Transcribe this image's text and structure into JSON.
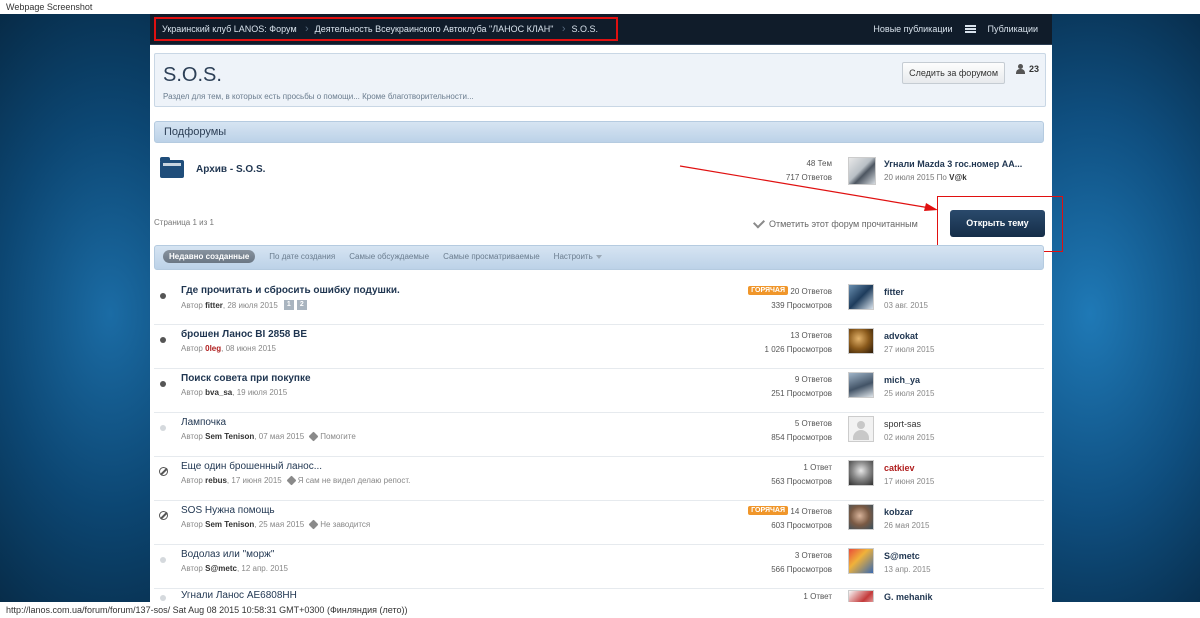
{
  "window": {
    "caption_top": "Webpage Screenshot",
    "caption_bottom": "http://lanos.com.ua/forum/forum/137-sos/ Sat Aug 08 2015 10:58:31 GMT+0300 (Финляндия (лето))"
  },
  "breadcrumb": [
    {
      "label": "Украинский клуб LANOS: Форум"
    },
    {
      "label": "Деятельность Всеукраинского Автоклуба \"ЛАНОС КЛАН\""
    },
    {
      "label": "S.O.S."
    }
  ],
  "topnav": {
    "new_posts": "Новые публикации",
    "publications": "Публикации"
  },
  "forum": {
    "title": "S.O.S.",
    "description": "Раздел для тем, в которых есть просьбы о помощи... Кроме благотворительности...",
    "follow_label": "Следить за форумом",
    "followers": "23"
  },
  "subforums": {
    "header": "Подфорумы",
    "items": [
      {
        "name": "Архив - S.O.S.",
        "topics": "48 Тем",
        "replies": "717 Ответов",
        "last_title": "Угнали Mazda 3 гос.номер АА...",
        "last_date": "20 июля 2015",
        "last_by_prefix": "По",
        "last_by": "V@k"
      }
    ]
  },
  "pagination": {
    "label": "Страница 1 из 1"
  },
  "actions": {
    "mark_read": "Отметить этот форум прочитанным",
    "new_topic": "Открыть тему"
  },
  "tabs": [
    {
      "label": "Недавно созданные",
      "active": true
    },
    {
      "label": "По дате создания"
    },
    {
      "label": "Самые обсуждаемые"
    },
    {
      "label": "Самые просматриваемые"
    },
    {
      "label": "Настроить"
    }
  ],
  "topics": [
    {
      "title": "Где прочитать и сбросить ошибку подушки.",
      "status": "unread",
      "author_prefix": "Автор",
      "author": "fitter",
      "date": "28 июля 2015",
      "pages": [
        "1",
        "2"
      ],
      "hot": "ГОРЯЧАЯ",
      "replies": "20 Ответов",
      "views": "339 Просмотров",
      "last_user": "fitter",
      "last_date": "03 авг. 2015"
    },
    {
      "title": "брошен Ланос BI 2858 BE",
      "status": "unread",
      "author_prefix": "Автор",
      "author": "0leg",
      "author_red": true,
      "date": "08 июня 2015",
      "replies": "13 Ответов",
      "views": "1 026 Просмотров",
      "last_user": "advokat",
      "last_date": "27 июля 2015"
    },
    {
      "title": "Поиск совета при покупке",
      "status": "unread",
      "author_prefix": "Автор",
      "author": "bva_sa",
      "date": "19 июля 2015",
      "replies": "9 Ответов",
      "views": "251 Просмотров",
      "last_user": "mich_ya",
      "last_date": "25 июля 2015"
    },
    {
      "title": "Лампочка",
      "status": "read",
      "author_prefix": "Автор",
      "author": "Sem Tenison",
      "date": "07 мая 2015",
      "tag": "Помогите",
      "replies": "5 Ответов",
      "views": "854 Просмотров",
      "last_user": "sport-sas",
      "last_user_plain": true,
      "last_date": "02 июля 2015"
    },
    {
      "title": "Еще один брошенный ланос...",
      "status": "locked",
      "author_prefix": "Автор",
      "author": "rebus",
      "date": "17 июня 2015",
      "tag": "Я сам не видел делаю репост.",
      "replies": "1 Ответ",
      "views": "563 Просмотров",
      "last_user": "catkiev",
      "last_user_red": true,
      "last_date": "17 июня 2015"
    },
    {
      "title": "SOS Нужна помощь",
      "status": "locked",
      "author_prefix": "Автор",
      "author": "Sem Tenison",
      "date": "25 мая 2015",
      "tag": "Не заводится",
      "hot": "ГОРЯЧАЯ",
      "replies": "14 Ответов",
      "views": "603 Просмотров",
      "last_user": "kobzar",
      "last_date": "26 мая 2015"
    },
    {
      "title": "Водолаз или \"морж\"",
      "status": "read",
      "author_prefix": "Автор",
      "author": "S@metc",
      "date": "12 апр. 2015",
      "replies": "3 Ответов",
      "views": "566 Просмотров",
      "last_user": "S@metc",
      "last_date": "13 апр. 2015"
    },
    {
      "title": "Угнали Ланос AE6808HH",
      "status": "read",
      "replies": "1 Ответ",
      "last_user": "G. mehanik"
    }
  ]
}
